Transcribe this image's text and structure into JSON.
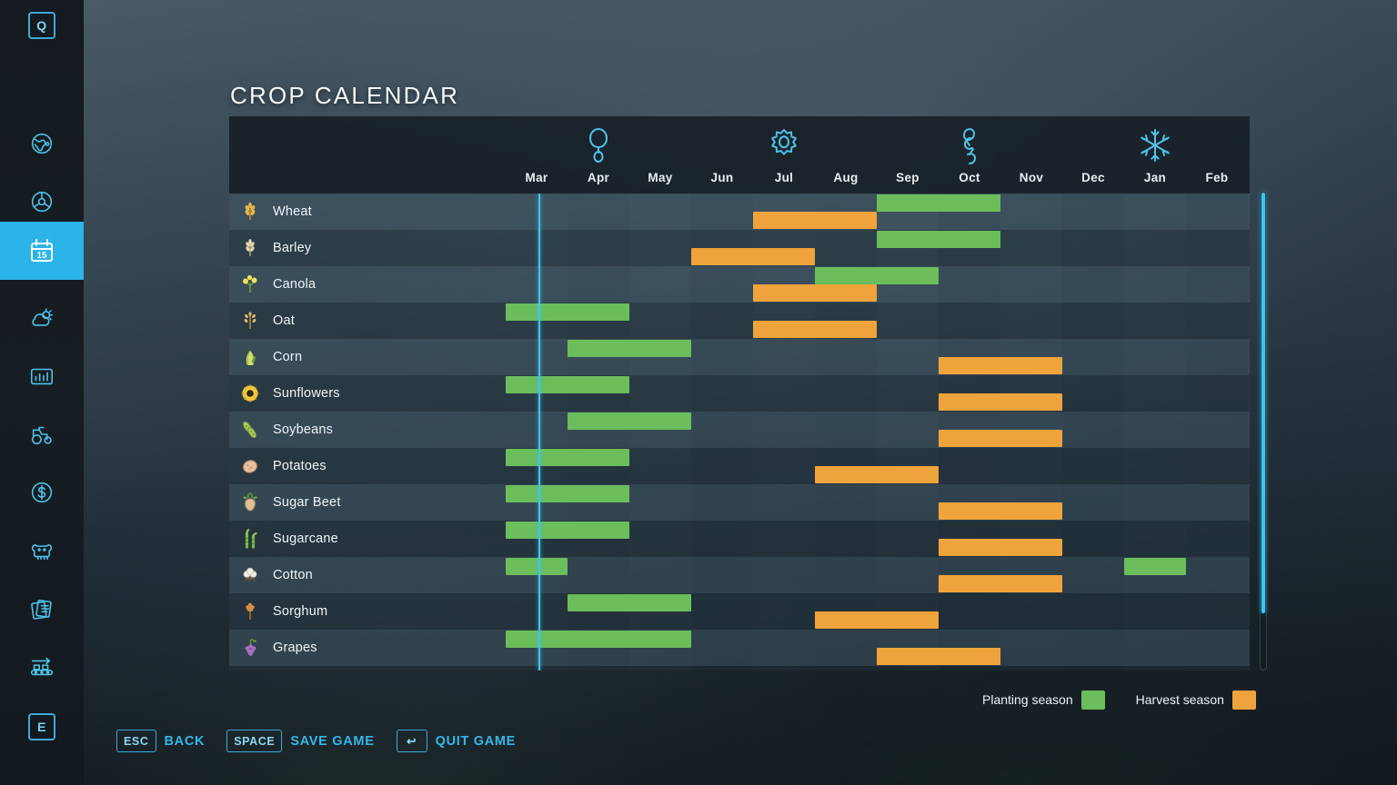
{
  "page_title": "CROP CALENDAR",
  "colors": {
    "planting": "#6cbd5b",
    "harvest": "#efa33c",
    "accent": "#2cb4e8",
    "marker": "#3bc6f0"
  },
  "sidebar": {
    "items": [
      {
        "name": "q-key-badge",
        "label": "Q",
        "type": "key",
        "active": false
      },
      {
        "name": "map-globe-icon",
        "label": "",
        "type": "icon",
        "active": false
      },
      {
        "name": "steering-wheel-icon",
        "label": "",
        "type": "icon",
        "active": false
      },
      {
        "name": "calendar-icon",
        "label": "15",
        "type": "icon",
        "active": true
      },
      {
        "name": "weather-icon",
        "label": "",
        "type": "icon",
        "active": false
      },
      {
        "name": "statistics-icon",
        "label": "",
        "type": "icon",
        "active": false
      },
      {
        "name": "vehicles-tractor-icon",
        "label": "",
        "type": "icon",
        "active": false
      },
      {
        "name": "finances-dollar-icon",
        "label": "",
        "type": "icon",
        "active": false
      },
      {
        "name": "animals-cow-icon",
        "label": "",
        "type": "icon",
        "active": false
      },
      {
        "name": "contracts-documents-icon",
        "label": "",
        "type": "icon",
        "active": false
      },
      {
        "name": "production-conveyor-icon",
        "label": "",
        "type": "icon",
        "active": false
      },
      {
        "name": "e-key-badge",
        "label": "E",
        "type": "key",
        "active": false
      }
    ]
  },
  "calendar": {
    "months": [
      "Mar",
      "Apr",
      "May",
      "Jun",
      "Jul",
      "Aug",
      "Sep",
      "Oct",
      "Nov",
      "Dec",
      "Jan",
      "Feb"
    ],
    "seasons": [
      {
        "name": "spring-leaf-icon",
        "month_index": 1
      },
      {
        "name": "summer-sun-icon",
        "month_index": 4
      },
      {
        "name": "autumn-leaves-icon",
        "month_index": 7
      },
      {
        "name": "winter-snowflake-icon",
        "month_index": 10
      }
    ],
    "current_month_index": 0,
    "current_day_fraction": 0.53,
    "crops": [
      {
        "name": "Wheat",
        "icon": "wheat-icon",
        "planting": [
          [
            6,
            8
          ]
        ],
        "harvest": [
          [
            4,
            6
          ]
        ]
      },
      {
        "name": "Barley",
        "icon": "barley-icon",
        "planting": [
          [
            6,
            8
          ]
        ],
        "harvest": [
          [
            3,
            5
          ]
        ]
      },
      {
        "name": "Canola",
        "icon": "canola-icon",
        "planting": [
          [
            5,
            7
          ]
        ],
        "harvest": [
          [
            4,
            6
          ]
        ]
      },
      {
        "name": "Oat",
        "icon": "oat-icon",
        "planting": [
          [
            0,
            2
          ]
        ],
        "harvest": [
          [
            4,
            6
          ]
        ]
      },
      {
        "name": "Corn",
        "icon": "corn-icon",
        "planting": [
          [
            1,
            3
          ]
        ],
        "harvest": [
          [
            7,
            9
          ]
        ]
      },
      {
        "name": "Sunflowers",
        "icon": "sunflower-icon",
        "planting": [
          [
            0,
            2
          ]
        ],
        "harvest": [
          [
            7,
            9
          ]
        ]
      },
      {
        "name": "Soybeans",
        "icon": "soybean-icon",
        "planting": [
          [
            1,
            3
          ]
        ],
        "harvest": [
          [
            7,
            9
          ]
        ]
      },
      {
        "name": "Potatoes",
        "icon": "potato-icon",
        "planting": [
          [
            0,
            2
          ]
        ],
        "harvest": [
          [
            5,
            7
          ]
        ]
      },
      {
        "name": "Sugar Beet",
        "icon": "sugarbeet-icon",
        "planting": [
          [
            0,
            2
          ]
        ],
        "harvest": [
          [
            7,
            9
          ]
        ]
      },
      {
        "name": "Sugarcane",
        "icon": "sugarcane-icon",
        "planting": [
          [
            0,
            2
          ]
        ],
        "harvest": [
          [
            7,
            9
          ]
        ]
      },
      {
        "name": "Cotton",
        "icon": "cotton-icon",
        "planting": [
          [
            0,
            1
          ],
          [
            10,
            11
          ]
        ],
        "harvest": [
          [
            7,
            9
          ]
        ]
      },
      {
        "name": "Sorghum",
        "icon": "sorghum-icon",
        "planting": [
          [
            1,
            3
          ]
        ],
        "harvest": [
          [
            5,
            7
          ]
        ]
      },
      {
        "name": "Grapes",
        "icon": "grapes-icon",
        "planting": [
          [
            0,
            3
          ]
        ],
        "harvest": [
          [
            6,
            8
          ]
        ]
      }
    ]
  },
  "legend": {
    "planting_label": "Planting season",
    "harvest_label": "Harvest season"
  },
  "footer": {
    "buttons": [
      {
        "key": "ESC",
        "label": "BACK",
        "name": "back-button"
      },
      {
        "key": "SPACE",
        "label": "SAVE GAME",
        "name": "save-game-button"
      },
      {
        "key": "↩",
        "label": "QUIT GAME",
        "name": "quit-game-button"
      }
    ]
  },
  "scrollbar": {
    "thumb_fraction": 0.88
  }
}
